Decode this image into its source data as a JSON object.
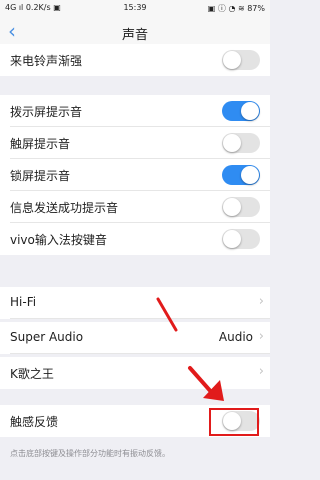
{
  "status_bar": {
    "left": "4G ıl 0.2K/s ▣",
    "time": "15:39",
    "right": "▣ ⓘ ◔ ≋ 87%"
  },
  "nav": {
    "title": "声音"
  },
  "rows": [
    {
      "label": "来电铃声渐强",
      "toggle": false
    },
    {
      "label": "拨示屏提示音",
      "toggle": true
    },
    {
      "label": "触屏提示音",
      "toggle": false
    },
    {
      "label": "锁屏提示音",
      "toggle": true
    },
    {
      "label": "信息发送成功提示音",
      "toggle": false
    },
    {
      "label": "vivo输入法按键音",
      "toggle": false
    },
    {
      "label": "Hi-Fi"
    },
    {
      "label": "Super Audio",
      "value": "Audio"
    },
    {
      "label": "K歌之王"
    },
    {
      "label": "触感反馈",
      "toggle": false
    }
  ],
  "footer": {
    "note": "点击底部按键及操作部分功能时有振动反馈。"
  },
  "annotation": {
    "highlight_color": "#e11b1b"
  },
  "icons": {
    "back": "‹",
    "chevron": "›"
  }
}
